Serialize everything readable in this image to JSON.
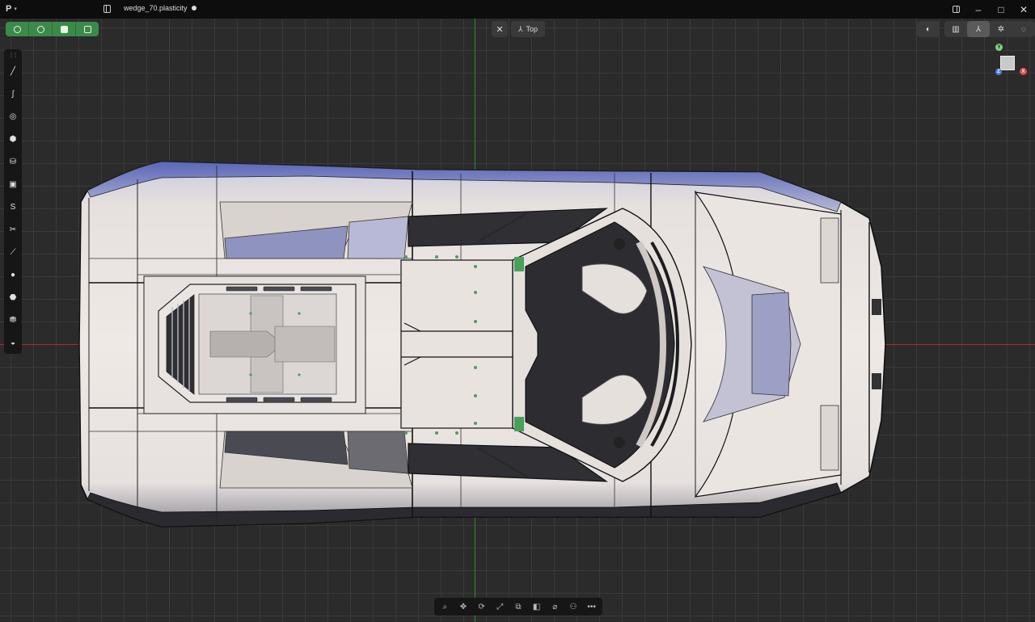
{
  "app": {
    "logo": "P",
    "file_name": "wedge_70.plasticity"
  },
  "window_controls": {
    "layout": "layout-icon",
    "minimize": "–",
    "maximize": "□",
    "close": "✕"
  },
  "select_modes": [
    {
      "name": "vertex-select-mode",
      "icon": "vertex-icon"
    },
    {
      "name": "edge-select-mode",
      "icon": "edge-icon"
    },
    {
      "name": "face-select-mode",
      "icon": "face-icon"
    },
    {
      "name": "solid-select-mode",
      "icon": "solid-icon"
    }
  ],
  "view": {
    "close_symbol": "✕",
    "label": "Top"
  },
  "right_toolbar": {
    "items": [
      {
        "name": "xray-toggle",
        "icon": "contrast-icon"
      },
      {
        "name": "perspective-toggle",
        "icon": "perspective-icon"
      },
      {
        "name": "orthographic-toggle",
        "icon": "ortho-icon"
      },
      {
        "name": "render-mode",
        "icon": "render-icon"
      },
      {
        "name": "shading-mode",
        "icon": "shading-icon"
      }
    ]
  },
  "gizmo": {
    "y": "Y",
    "x": "X",
    "z": "Z"
  },
  "colors": {
    "accent_green": "#3c8a4a",
    "axis_x": "#b02828",
    "axis_y": "#2e8a2e",
    "grid": "#3a3a3a",
    "background": "#2b2b2b"
  },
  "left_toolbar": [
    "line-icon",
    "curve-icon",
    "circle-icon",
    "polygon-icon",
    "cylinder-icon",
    "rectangle-icon",
    "spiral-icon",
    "scissors-icon",
    "spline-icon",
    "sphere-icon",
    "box-icon",
    "database-icon",
    "primitive-icon"
  ],
  "bottom_toolbar": [
    "search-icon",
    "move-icon",
    "rotate-icon",
    "scale-icon",
    "offset-icon",
    "boolean-icon",
    "attach-icon",
    "material-icon",
    "more-icon"
  ]
}
